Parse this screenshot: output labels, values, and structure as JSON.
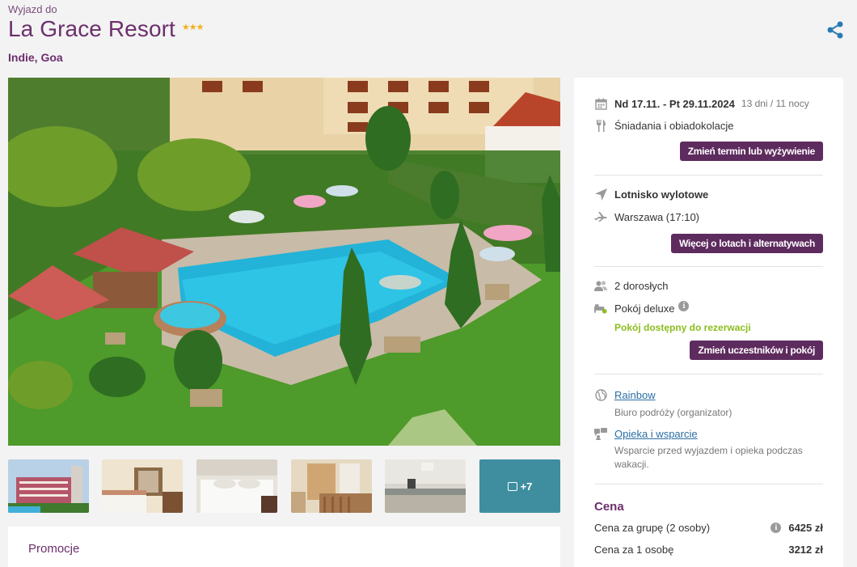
{
  "header": {
    "eyebrow": "Wyjazd do",
    "title": "La Grace Resort",
    "stars": "★★★",
    "location": "Indie, Goa"
  },
  "gallery": {
    "more_label": "+7"
  },
  "promo": {
    "title": "Promocje"
  },
  "booking": {
    "dates": "Nd 17.11. - Pt 29.11.2024",
    "duration": "13 dni / 11 nocy",
    "board": "Śniadania i obiadokolacje",
    "change_dates_button": "Zmień termin lub wyżywienie",
    "airport_label": "Lotnisko wylotowe",
    "airport_value": "Warszawa (17:10)",
    "flights_button": "Więcej o lotach i alternatywach",
    "travellers": "2 dorosłych",
    "room": "Pokój deluxe",
    "room_status": "Pokój dostępny do rezerwacji",
    "change_room_button": "Zmień uczestników i pokój",
    "organizer_link": "Rainbow",
    "organizer_desc": "Biuro podróży (organizator)",
    "support_link": "Opieka i wsparcie",
    "support_desc": "Wsparcie przed wyjazdem i opieka podczas wakacji."
  },
  "price": {
    "title": "Cena",
    "group_label": "Cena za grupę (2 osoby)",
    "group_value": "6425 zł",
    "per_person_label": "Cena za 1 osobę",
    "per_person_value": "3212 zł"
  },
  "colors": {
    "brand": "#6c2f6c",
    "button": "#5e2b5e",
    "available": "#8cbd1e",
    "link": "#2b6ea5",
    "share": "#2a7bb5"
  }
}
